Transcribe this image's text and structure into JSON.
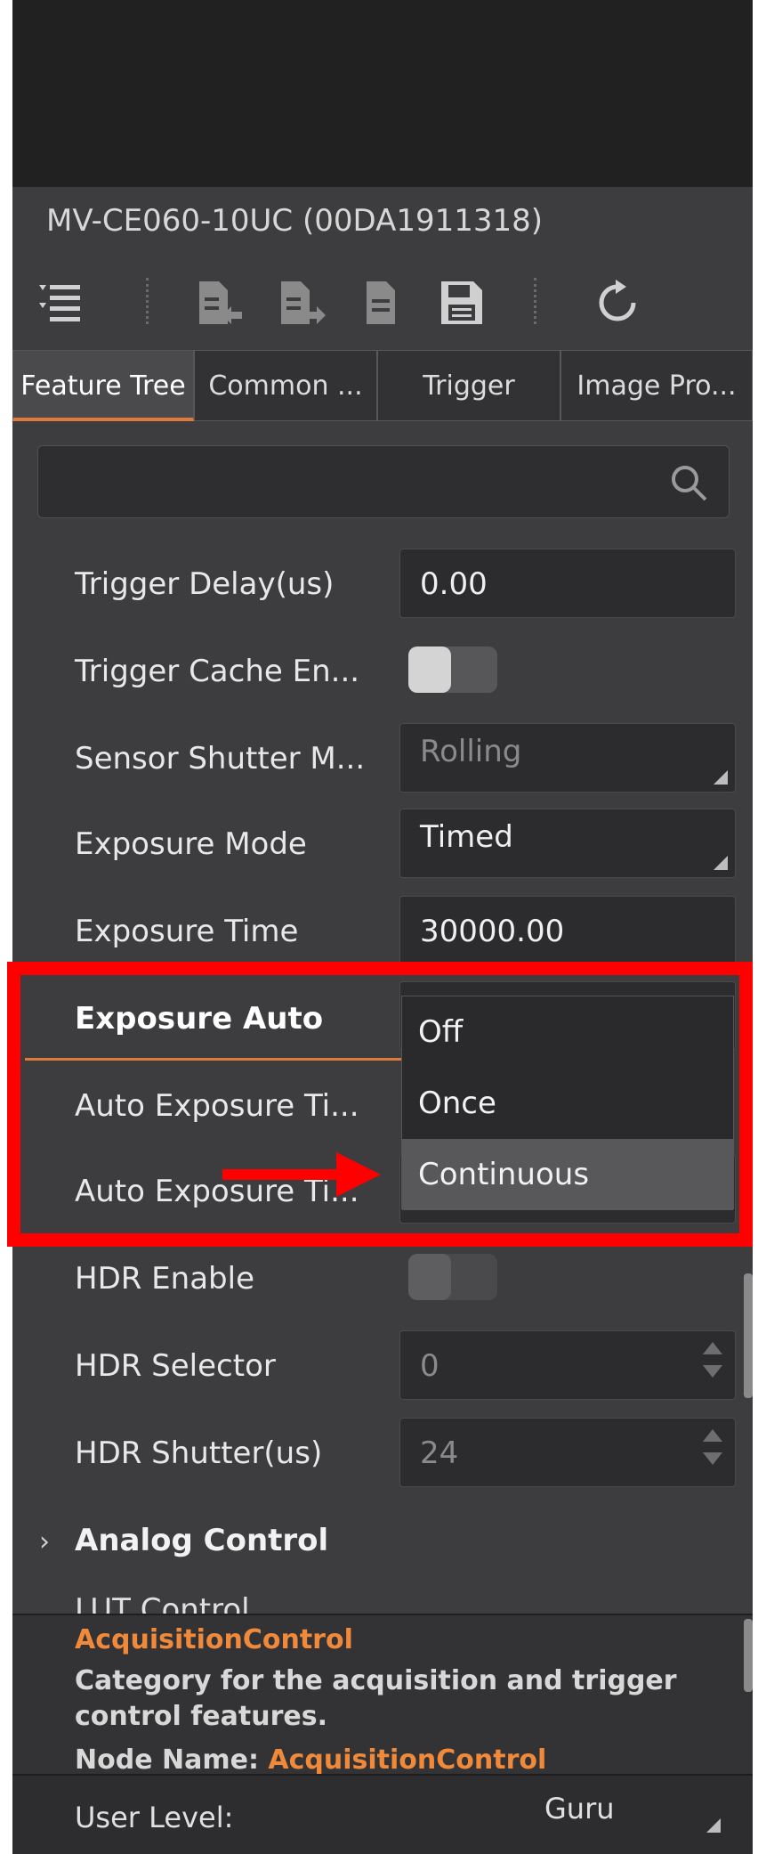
{
  "device": {
    "title": "MV-CE060-10UC (00DA1911318)"
  },
  "toolbar": {
    "icons": [
      "tree-list-icon",
      "import-icon",
      "export-icon",
      "document-icon",
      "save-icon",
      "refresh-icon"
    ]
  },
  "tabs": [
    {
      "label": "Feature Tree",
      "active": true
    },
    {
      "label": "Common ...",
      "active": false
    },
    {
      "label": "Trigger",
      "active": false
    },
    {
      "label": "Image Pro...",
      "active": false
    }
  ],
  "search": {
    "placeholder": ""
  },
  "features": {
    "trigger_delay": {
      "label": "Trigger Delay(us)",
      "value": "0.00"
    },
    "trigger_cache": {
      "label": "Trigger Cache En...",
      "value": "off"
    },
    "sensor_shutter": {
      "label": "Sensor Shutter M...",
      "value": "Rolling"
    },
    "exposure_mode": {
      "label": "Exposure Mode",
      "value": "Timed"
    },
    "exposure_time": {
      "label": "Exposure Time",
      "value": "30000.00"
    },
    "exposure_auto": {
      "label": "Exposure Auto"
    },
    "auto_exp_1": {
      "label": "Auto Exposure Ti..."
    },
    "auto_exp_2": {
      "label": "Auto Exposure Ti..."
    },
    "hdr_enable": {
      "label": "HDR Enable",
      "value": "off"
    },
    "hdr_selector": {
      "label": "HDR Selector",
      "value": "0"
    },
    "hdr_shutter": {
      "label": "HDR Shutter(us)",
      "value": "24"
    }
  },
  "dropdown_options": [
    {
      "label": "Off",
      "selected": false
    },
    {
      "label": "Once",
      "selected": false
    },
    {
      "label": "Continuous",
      "selected": true
    }
  ],
  "section": {
    "analog_control": "Analog Control",
    "cut_label": "LUT Control"
  },
  "description": {
    "title": "AcquisitionControl",
    "body": "Category for the acquisition and trigger control features.",
    "node_label": "Node Name:",
    "node_value": "AcquisitionControl"
  },
  "user_level": {
    "label": "User Level:",
    "value": "Guru"
  },
  "colors": {
    "accent": "#e07a3a",
    "highlight": "#fe0000",
    "panel_bg": "#3d3d3f"
  }
}
